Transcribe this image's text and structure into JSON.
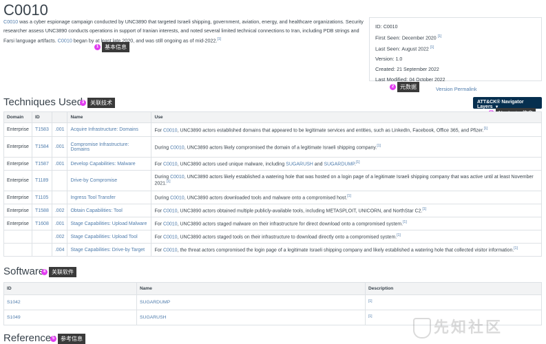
{
  "page": {
    "title": "C0010",
    "description": {
      "link1": "C0010",
      "text1": " was a cyber espionage campaign conducted by UNC3890 that targeted Israeli shipping, government, aviation, energy, and healthcare organizations. Security researcher assess UNC3890 conducts operations in support of Iranian interests, and noted several limited technical connections to Iran, including PDB strings and Farsi language artifacts. ",
      "link2": "C0010",
      "text2": " began by at least late 2020, and was still ongoing as of mid-2022.",
      "ref": "[1]"
    }
  },
  "meta": {
    "id_label": "ID: ",
    "id_value": "C0010",
    "first_seen_label": "First Seen: ",
    "first_seen_value": "December 2020",
    "first_seen_ref": "[1]",
    "last_seen_label": "Last Seen: ",
    "last_seen_value": "August 2022",
    "last_seen_ref": "[1]",
    "version_label": "Version: ",
    "version_value": "1.0",
    "created_label": "Created: ",
    "created_value": "21 September 2022",
    "modified_label": "Last Modified: ",
    "modified_value": "04 October 2022",
    "permalink": "Version Permalink"
  },
  "annotations": {
    "a1": {
      "num": "1",
      "label": "基本信息"
    },
    "a2": {
      "num": "2",
      "label": "元数据"
    },
    "a3": {
      "num": "3",
      "label": "关联技术"
    },
    "a4": {
      "num": "4",
      "label": "关联软件"
    },
    "a5": {
      "num": "5",
      "label": "参考信息"
    },
    "a6": {
      "num": "6",
      "label": "Navigator信息"
    }
  },
  "techniques": {
    "heading": "Techniques Used",
    "navigator_button": "ATT&CK® Navigator Layers",
    "headers": [
      "Domain",
      "ID",
      "",
      "Name",
      "Use"
    ],
    "rows": [
      {
        "domain": "Enterprise",
        "id": "T1583",
        "sub": ".001",
        "name": "Acquire Infrastructure: Domains",
        "use_pre": "For ",
        "use_link": "C0010",
        "use_post": ", UNC3890 actors established domains that appeared to be legitimate services and entities, such as LinkedIn, Facebook, Office 365, and Pfizer.",
        "ref": "[1]"
      },
      {
        "domain": "Enterprise",
        "id": "T1584",
        "sub": ".001",
        "name": "Compromise Infrastructure: Domains",
        "use_pre": "During ",
        "use_link": "C0010",
        "use_post": ", UNC3890 actors likely compromised the domain of a legitimate Israeli shipping company.",
        "ref": "[1]"
      },
      {
        "domain": "Enterprise",
        "id": "T1587",
        "sub": ".001",
        "name": "Develop Capabilities: Malware",
        "use_pre": "For ",
        "use_link": "C0010",
        "use_post": ", UNC3890 actors used unique malware, including ",
        "use_link2": "SUGARUSH",
        "use_mid": " and ",
        "use_link3": "SUGARDUMP",
        "use_end": ".",
        "ref": "[1]"
      },
      {
        "domain": "Enterprise",
        "id": "T1189",
        "sub": "",
        "name": "Drive-by Compromise",
        "use_pre": "During ",
        "use_link": "C0010",
        "use_post": ", UNC3890 actors likely established a watering hole that was hosted on a login page of a legitimate Israeli shipping company that was active until at least November 2021.",
        "ref": "[1]"
      },
      {
        "domain": "Enterprise",
        "id": "T1105",
        "sub": "",
        "name": "Ingress Tool Transfer",
        "use_pre": "During ",
        "use_link": "C0010",
        "use_post": ", UNC3890 actors downloaded tools and malware onto a compromised host.",
        "ref": "[1]"
      },
      {
        "domain": "Enterprise",
        "id": "T1588",
        "sub": ".002",
        "name": "Obtain Capabilities: Tool",
        "use_pre": "For ",
        "use_link": "C0010",
        "use_post": ", UNC3890 actors obtained multiple publicly-available tools, including METASPLOIT, UNICORN, and NorthStar C2.",
        "ref": "[1]"
      },
      {
        "domain": "Enterprise",
        "id": "T1608",
        "sub": ".001",
        "name": "Stage Capabilities: Upload Malware",
        "use_pre": "For ",
        "use_link": "C0010",
        "use_post": ", UNC3890 actors staged malware on their infrastructure for direct download onto a compromised system.",
        "ref": "[1]"
      },
      {
        "domain": "",
        "id": "",
        "sub": ".002",
        "name": "Stage Capabilities: Upload Tool",
        "use_pre": "For ",
        "use_link": "C0010",
        "use_post": ", UNC3890 actors staged tools on their infrastructure to download directly onto a compromised system.",
        "ref": "[1]"
      },
      {
        "domain": "",
        "id": "",
        "sub": ".004",
        "name": "Stage Capabilities: Drive-by Target",
        "use_pre": "For ",
        "use_link": "C0010",
        "use_post": ", the threat actors compromised the login page of a legitimate Israeli shipping company and likely established a watering hole that collected visitor information.",
        "ref": "[1]"
      }
    ]
  },
  "software": {
    "heading": "Software",
    "headers": [
      "ID",
      "Name",
      "Description"
    ],
    "rows": [
      {
        "id": "S1042",
        "name": "SUGARDUMP",
        "desc": "[1]"
      },
      {
        "id": "S1049",
        "name": "SUGARUSH",
        "desc": "[1]"
      }
    ]
  },
  "references": {
    "heading": "References"
  },
  "watermark": "先知社区",
  "colors": {
    "link": "#4f7cac",
    "nav_button": "#062f4f",
    "annotation_dot": "#e13cf0",
    "annotation_label_bg": "#3a3a3a"
  }
}
